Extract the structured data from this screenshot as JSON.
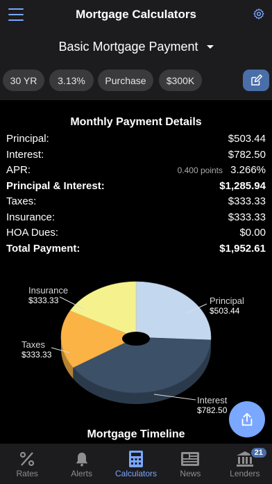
{
  "header": {
    "title": "Mortgage Calculators"
  },
  "selector": {
    "label": "Basic Mortgage Payment"
  },
  "chips": [
    "30 YR",
    "3.13%",
    "Purchase",
    "$300K"
  ],
  "details": {
    "title": "Monthly Payment Details",
    "principal": {
      "label": "Principal:",
      "value": "$503.44"
    },
    "interest": {
      "label": "Interest:",
      "value": "$782.50"
    },
    "apr": {
      "label": "APR:",
      "note": "0.400 points",
      "value": "3.266%"
    },
    "pi": {
      "label": "Principal & Interest:",
      "value": "$1,285.94"
    },
    "taxes": {
      "label": "Taxes:",
      "value": "$333.33"
    },
    "insurance": {
      "label": "Insurance:",
      "value": "$333.33"
    },
    "hoa": {
      "label": "HOA Dues:",
      "value": "$0.00"
    },
    "total": {
      "label": "Total Payment:",
      "value": "$1,952.61"
    }
  },
  "chart_data": {
    "type": "pie",
    "categories": [
      "Principal",
      "Interest",
      "Taxes",
      "Insurance"
    ],
    "values": [
      503.44,
      782.5,
      333.33,
      333.33
    ],
    "value_labels": [
      "$503.44",
      "$782.50",
      "$333.33",
      "$333.33"
    ],
    "colors": [
      "#c3d7ef",
      "#3c5068",
      "#fbb346",
      "#f5f28e"
    ]
  },
  "timeline": {
    "title": "Mortgage Timeline"
  },
  "tabs": {
    "rates": "Rates",
    "alerts": "Alerts",
    "calculators": "Calculators",
    "news": "News",
    "lenders": "Lenders",
    "lenders_badge": "21"
  },
  "colors": {
    "accent": "#7aa7ff",
    "panel": "#1c1c1e",
    "chip": "#3a3a3c"
  }
}
